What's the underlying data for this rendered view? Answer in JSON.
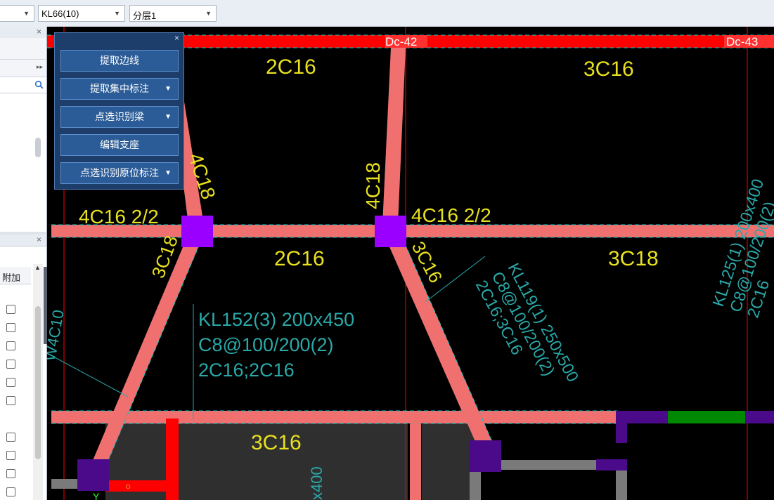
{
  "toolbar": {
    "combo_left_value": "",
    "combo_beam": "KL66(10)",
    "combo_layer": "分层1"
  },
  "left_panel": {
    "column_header": "附加",
    "checkbox_count": 10
  },
  "tool_panel": {
    "buttons": [
      {
        "label": "提取边线",
        "dropdown": false
      },
      {
        "label": "提取集中标注",
        "dropdown": true
      },
      {
        "label": "点选识别梁",
        "dropdown": true
      },
      {
        "label": "编辑支座",
        "dropdown": false
      },
      {
        "label": "点选识别原位标注",
        "dropdown": true
      }
    ]
  },
  "drawing": {
    "axis_labels": [
      "Dc-42",
      "Dc-43"
    ],
    "annotations": {
      "top_left": "2C16",
      "top_right": "3C16",
      "diag_upper_left": "4C18",
      "center_vertical": "4C18",
      "mid_left": "4C16 2/2",
      "mid_center": "4C16 2/2",
      "mid_span_left": "2C16",
      "mid_span_right": "3C18",
      "diag_lower_left": "3C18",
      "diag_lower_center": "3C16",
      "bottom_span": "3C16",
      "left_edge_partial": "W4C10",
      "bottom_partial": "x400"
    },
    "beam_kl152": [
      "KL152(3) 200x450",
      "C8@100/200(2)",
      "2C16;2C16"
    ],
    "beam_kl119": [
      "KL119(1) 250x500",
      "C8@100/200(2)",
      "2C16;3C16"
    ],
    "beam_kl125": [
      "KL125(1) 200x400",
      "C8@100/200(2)",
      "2C16"
    ],
    "colors": {
      "beam": "#f07070",
      "column": "#9900ff",
      "column_dark": "#4a0a8a",
      "axis_red": "#ff0000",
      "text_yellow": "#e8e020",
      "text_cyan": "#2aa8a8",
      "green": "#008800"
    }
  }
}
